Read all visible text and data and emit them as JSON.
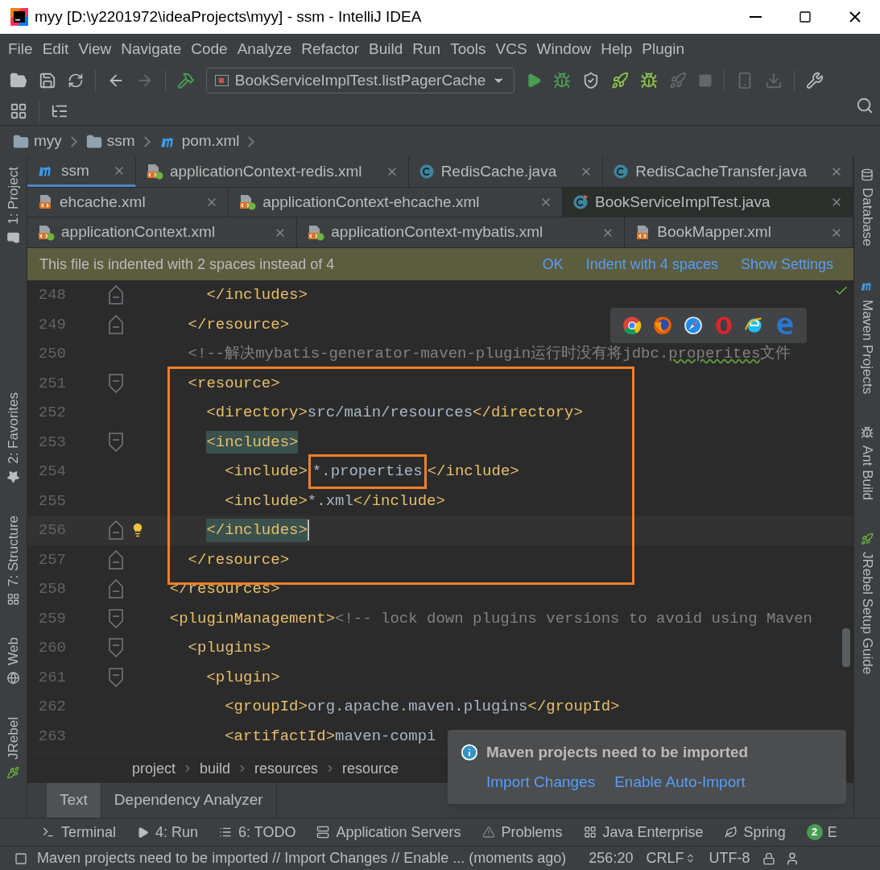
{
  "window": {
    "title": "myy [D:\\y2201972\\ideaProjects\\myy] - ssm - IntelliJ IDEA"
  },
  "menu": [
    "File",
    "Edit",
    "View",
    "Navigate",
    "Code",
    "Analyze",
    "Refactor",
    "Build",
    "Run",
    "Tools",
    "VCS",
    "Window",
    "Help",
    "Plugin"
  ],
  "run_config": {
    "label": "BookServiceImplTest.listPagerCache"
  },
  "navigation": [
    {
      "label": "myy",
      "kind": "folder"
    },
    {
      "label": "ssm",
      "kind": "folder"
    },
    {
      "label": "pom.xml",
      "kind": "maven"
    }
  ],
  "left_tool_windows": [
    {
      "label": "1: Project",
      "kind": "folder"
    },
    {
      "label": "2: Favorites",
      "kind": "star"
    },
    {
      "label": "7: Structure",
      "kind": "structure"
    },
    {
      "label": "Web",
      "kind": "globe"
    },
    {
      "label": "JRebel",
      "kind": "rocket"
    }
  ],
  "tab_rows": [
    {
      "tabs": [
        {
          "label": "ssm",
          "kind": "maven",
          "selected": true,
          "hovered": false
        },
        {
          "label": "applicationContext-redis.xml",
          "kind": "spring",
          "selected": false,
          "hovered": false
        },
        {
          "label": "RedisCache.java",
          "kind": "class",
          "selected": false,
          "hovered": false
        },
        {
          "label": "RedisCacheTransfer.java",
          "kind": "class",
          "selected": false,
          "hovered": false
        }
      ]
    },
    {
      "tabs": [
        {
          "label": "ehcache.xml",
          "kind": "xml",
          "selected": false,
          "hovered": false
        },
        {
          "label": "applicationContext-ehcache.xml",
          "kind": "spring",
          "selected": false,
          "hovered": false
        },
        {
          "label": "BookServiceImplTest.java",
          "kind": "test",
          "selected": false,
          "hovered": true
        }
      ]
    },
    {
      "tabs": [
        {
          "label": "applicationContext.xml",
          "kind": "spring",
          "selected": false,
          "hovered": false
        },
        {
          "label": "applicationContext-mybatis.xml",
          "kind": "spring",
          "selected": false,
          "hovered": false
        },
        {
          "label": "BookMapper.xml",
          "kind": "xml",
          "selected": false,
          "hovered": false
        }
      ]
    }
  ],
  "banner": {
    "message": "This file is indented with 2 spaces instead of 4",
    "actions": [
      "OK",
      "Indent with 4 spaces",
      "Show Settings"
    ]
  },
  "code_lines": [
    {
      "number": "248",
      "kind": "end",
      "current": false,
      "bulb": false,
      "segments": [
        {
          "text": "      </includes>",
          "kind": "tag"
        }
      ]
    },
    {
      "number": "249",
      "kind": "end",
      "current": false,
      "bulb": false,
      "segments": [
        {
          "text": "    </resource>",
          "kind": "tag"
        }
      ]
    },
    {
      "number": "250",
      "kind": "plain",
      "current": false,
      "bulb": false,
      "segments": [
        {
          "text": "    <!--解决mybatis-generator-maven-plugin运行时没有将jdbc.",
          "kind": "comment"
        },
        {
          "text": "properites",
          "kind": "typo"
        },
        {
          "text": "文件",
          "kind": "comment"
        }
      ]
    },
    {
      "number": "251",
      "kind": "start",
      "current": false,
      "bulb": false,
      "segments": [
        {
          "text": "    <resource>",
          "kind": "tag"
        }
      ]
    },
    {
      "number": "252",
      "kind": "plain",
      "current": false,
      "bulb": false,
      "segments": [
        {
          "text": "      <directory>",
          "kind": "tag"
        },
        {
          "text": "src/main/resources",
          "kind": "text"
        },
        {
          "text": "</directory>",
          "kind": "tag"
        }
      ]
    },
    {
      "number": "253",
      "kind": "start",
      "current": false,
      "bulb": false,
      "segments": [
        {
          "text": "      <includes>",
          "kind": "match"
        }
      ]
    },
    {
      "number": "254",
      "kind": "plain",
      "current": false,
      "bulb": false,
      "segments": [
        {
          "text": "        <include>",
          "kind": "tag"
        },
        {
          "text": "*.properties",
          "kind": "framed"
        },
        {
          "text": "</include>",
          "kind": "tag"
        }
      ]
    },
    {
      "number": "255",
      "kind": "plain",
      "current": false,
      "bulb": false,
      "segments": [
        {
          "text": "        <include>",
          "kind": "tag"
        },
        {
          "text": "*.xml",
          "kind": "text"
        },
        {
          "text": "</include>",
          "kind": "tag"
        }
      ]
    },
    {
      "number": "256",
      "kind": "end",
      "current": true,
      "bulb": true,
      "segments": [
        {
          "text": "      </includes>",
          "kind": "match"
        }
      ]
    },
    {
      "number": "257",
      "kind": "end",
      "current": false,
      "bulb": false,
      "segments": [
        {
          "text": "    </resource>",
          "kind": "tag"
        }
      ]
    },
    {
      "number": "258",
      "kind": "end",
      "current": false,
      "bulb": false,
      "segments": [
        {
          "text": "  </resources>",
          "kind": "tag"
        }
      ]
    },
    {
      "number": "259",
      "kind": "start",
      "current": false,
      "bulb": false,
      "segments": [
        {
          "text": "  <pluginManagement>",
          "kind": "tag"
        },
        {
          "text": "<!-- lock down plugins versions to avoid using Maven",
          "kind": "comment"
        }
      ]
    },
    {
      "number": "260",
      "kind": "start",
      "current": false,
      "bulb": false,
      "segments": [
        {
          "text": "    <plugins>",
          "kind": "tag"
        }
      ]
    },
    {
      "number": "261",
      "kind": "start",
      "current": false,
      "bulb": false,
      "segments": [
        {
          "text": "      <plugin>",
          "kind": "tag"
        }
      ]
    },
    {
      "number": "262",
      "kind": "plain",
      "current": false,
      "bulb": false,
      "segments": [
        {
          "text": "        <groupId>",
          "kind": "tag"
        },
        {
          "text": "org.apache.maven.plugins",
          "kind": "text"
        },
        {
          "text": "</groupId>",
          "kind": "tag"
        }
      ]
    },
    {
      "number": "263",
      "kind": "plain",
      "current": false,
      "bulb": false,
      "segments": [
        {
          "text": "        <artifactId>",
          "kind": "tag"
        },
        {
          "text": "maven-compi",
          "kind": "text"
        }
      ]
    }
  ],
  "editor_breadcrumb": [
    "project",
    "build",
    "resources",
    "resource"
  ],
  "editor_bottom_tabs": [
    {
      "label": "Text",
      "selected": true
    },
    {
      "label": "Dependency Analyzer",
      "selected": false
    }
  ],
  "notification": {
    "title": "Maven projects need to be imported",
    "actions": [
      "Import Changes",
      "Enable Auto-Import"
    ]
  },
  "right_tool_windows": [
    {
      "label": "Database",
      "kind": "database"
    },
    {
      "label": "Maven Projects",
      "kind": "maven"
    },
    {
      "label": "Ant Build",
      "kind": "ant"
    },
    {
      "label": "JRebel Setup Guide",
      "kind": "rocket"
    }
  ],
  "tool_windows": [
    {
      "label": "Terminal",
      "kind": "terminal"
    },
    {
      "label": "4: Run",
      "kind": "run"
    },
    {
      "label": "6: TODO",
      "kind": "list"
    },
    {
      "label": "Application Servers",
      "kind": "servers"
    },
    {
      "label": "Problems",
      "kind": "warning"
    },
    {
      "label": "Java Enterprise",
      "kind": "ee"
    },
    {
      "label": "Spring",
      "kind": "leaf"
    }
  ],
  "event_log": {
    "count": "2",
    "label": "E"
  },
  "status_bar": {
    "message": "Maven projects need to be imported // Import Changes // Enable ... (moments ago)",
    "position": "256:20",
    "line_separator": "CRLF",
    "encoding": "UTF-8"
  }
}
